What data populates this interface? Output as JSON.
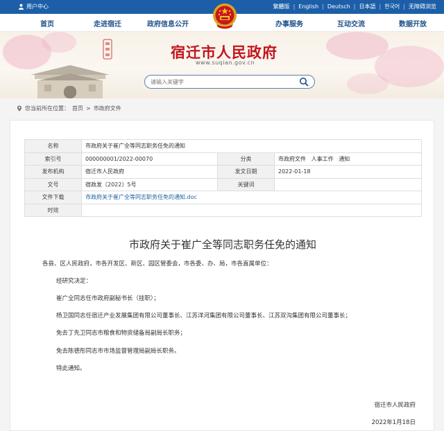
{
  "topbar": {
    "user_center": "用户中心",
    "languages": [
      "繁體版",
      "English",
      "Deutsch",
      "日本語",
      "한국어",
      "无障碍浏览"
    ]
  },
  "nav": {
    "items": [
      "首页",
      "走进宿迁",
      "政府信息公开",
      "办事服务",
      "互动交流",
      "数据开放"
    ]
  },
  "banner": {
    "site_title": "宿迁市人民政府",
    "site_url": "www.suqian.gov.cn",
    "search_placeholder": "请输入关键字"
  },
  "breadcrumb": {
    "prefix": "您当前所在位置：",
    "home": "首页",
    "separator": ">",
    "current": "市政府文件"
  },
  "meta": {
    "name_label": "名称",
    "name_value": "市政府关于崔广全等同志职务任免的通知",
    "index_label": "索引号",
    "index_value": "000000001/2022-00070",
    "category_label": "分类",
    "category_value": "市政府文件   人事工作   通知",
    "publisher_label": "发布机构",
    "publisher_value": "宿迁市人民政府",
    "date_label": "发文日期",
    "date_value": "2022-01-18",
    "docno_label": "文号",
    "docno_value": "宿政发〔2022〕5号",
    "keyword_label": "关键词",
    "keyword_value": "",
    "download_label": "文件下载",
    "download_value": "市政府关于崔广全等同志职务任免的通知.doc",
    "validity_label": "时效",
    "validity_value": ""
  },
  "document": {
    "title": "市政府关于崔广全等同志职务任免的通知",
    "salutation": "各县、区人民政府，市各开发区、新区、园区管委会，市各委、办、局，市各直属单位：",
    "paragraphs": [
      "经研究决定：",
      "崔广全同志任市政府副秘书长（挂职）；",
      "杨卫国同志任宿迁产业发展集团有限公司董事长、江苏洋河集团有限公司董事长、江苏双沟集团有限公司董事长；",
      "免去丁先卫同志市粮食和物资储备局副局长职务；",
      "免去陈德彤同志市市场监督管理局副局长职务。",
      "特此通知。"
    ],
    "signer": "宿迁市人民政府",
    "sign_date": "2022年1月18日"
  },
  "colors": {
    "topbar": "#1c5fa8",
    "nav_text": "#1c4f8a",
    "title_red": "#c2141c",
    "link": "#1c5fa8"
  }
}
